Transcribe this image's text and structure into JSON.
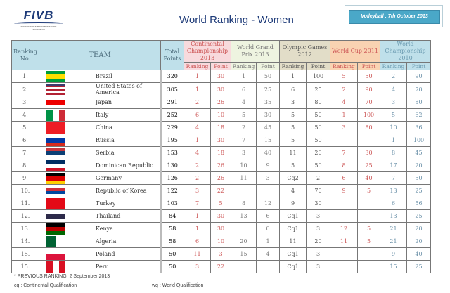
{
  "logo": {
    "name": "FIVB",
    "subtitle": "FEDERATION INTERNATIONALE DE VOLLEYBALL"
  },
  "title": "World Ranking - Women",
  "date_label": "Volleyball : 7th October 2013",
  "headers": {
    "rank": "Ranking No.",
    "team": "TEAM",
    "total": "Total Points",
    "cc": "Continental Championship 2013",
    "gp": "World Grand Prix 2013",
    "og": "Olympic Games 2012",
    "wc": "World Cup 2011",
    "wch": "World Championship 2010",
    "sub_rank": "Ranking",
    "sub_point": "Point"
  },
  "rows": [
    {
      "no": "1.",
      "team": "Brazil",
      "total": "320",
      "v": [
        "1",
        "30",
        "1",
        "50",
        "1",
        "100",
        "5",
        "50",
        "2",
        "90"
      ],
      "flag": {
        "dir": "h",
        "colors": [
          "#009c3b",
          "#ffdf00",
          "#009c3b"
        ]
      }
    },
    {
      "no": "2.",
      "team": "United States of America",
      "total": "305",
      "v": [
        "1",
        "30",
        "6",
        "25",
        "6",
        "25",
        "2",
        "90",
        "4",
        "70"
      ],
      "flag": {
        "dir": "h",
        "colors": [
          "#3c3b6e",
          "#b22234",
          "#fff",
          "#b22234",
          "#fff",
          "#b22234"
        ]
      }
    },
    {
      "no": "3.",
      "team": "Japan",
      "total": "291",
      "v": [
        "2",
        "26",
        "4",
        "35",
        "3",
        "80",
        "4",
        "70",
        "3",
        "80"
      ],
      "flag": {
        "dir": "h",
        "colors": [
          "#fff",
          "#e00",
          "#fff"
        ]
      }
    },
    {
      "no": "4.",
      "team": "Italy",
      "total": "252",
      "v": [
        "6",
        "10",
        "5",
        "30",
        "5",
        "50",
        "1",
        "100",
        "5",
        "62"
      ],
      "flag": {
        "dir": "v",
        "colors": [
          "#009246",
          "#fff",
          "#ce2b37"
        ]
      }
    },
    {
      "no": "5.",
      "team": "China",
      "total": "229",
      "v": [
        "4",
        "18",
        "2",
        "45",
        "5",
        "50",
        "3",
        "80",
        "10",
        "36"
      ],
      "flag": {
        "dir": "h",
        "colors": [
          "#ee1c25"
        ]
      }
    },
    {
      "no": "6.",
      "team": "Russia",
      "total": "195",
      "v": [
        "1",
        "30",
        "7",
        "15",
        "5",
        "50",
        "",
        "",
        "1",
        "100"
      ],
      "flag": {
        "dir": "h",
        "colors": [
          "#fff",
          "#0039a6",
          "#d52b1e"
        ]
      }
    },
    {
      "no": "7.",
      "team": "Serbia",
      "total": "153",
      "v": [
        "4",
        "18",
        "3",
        "40",
        "11",
        "20",
        "7",
        "30",
        "8",
        "45"
      ],
      "flag": {
        "dir": "h",
        "colors": [
          "#c6363c",
          "#0c4076",
          "#fff"
        ]
      }
    },
    {
      "no": "8.",
      "team": "Dominican Republic",
      "total": "130",
      "v": [
        "2",
        "26",
        "10",
        "9",
        "5",
        "50",
        "8",
        "25",
        "17",
        "20"
      ],
      "flag": {
        "dir": "h",
        "colors": [
          "#002d62",
          "#fff",
          "#ce1126"
        ]
      }
    },
    {
      "no": "9.",
      "team": "Germany",
      "total": "126",
      "v": [
        "2",
        "26",
        "11",
        "3",
        "Cq2",
        "2",
        "6",
        "40",
        "7",
        "50"
      ],
      "flag": {
        "dir": "h",
        "colors": [
          "#000",
          "#dd0000",
          "#ffce00"
        ]
      }
    },
    {
      "no": "10.",
      "team": "Republic of Korea",
      "total": "122",
      "v": [
        "3",
        "22",
        "",
        "",
        "4",
        "70",
        "9",
        "5",
        "13",
        "25"
      ],
      "flag": {
        "dir": "h",
        "colors": [
          "#fff",
          "#cd2e3a",
          "#0047a0",
          "#fff"
        ]
      }
    },
    {
      "no": "11.",
      "team": "Turkey",
      "total": "103",
      "v": [
        "7",
        "5",
        "8",
        "12",
        "9",
        "30",
        "",
        "",
        "6",
        "56"
      ],
      "flag": {
        "dir": "h",
        "colors": [
          "#e30a17"
        ]
      }
    },
    {
      "no": "12.",
      "team": "Thailand",
      "total": "84",
      "v": [
        "1",
        "30",
        "13",
        "6",
        "Cq1",
        "3",
        "",
        "",
        "13",
        "25"
      ],
      "flag": {
        "dir": "h",
        "colors": [
          "#fff",
          "#2d2a4a",
          "#fff"
        ]
      }
    },
    {
      "no": "13.",
      "team": "Kenya",
      "total": "58",
      "v": [
        "1",
        "30",
        "",
        "0",
        "Cq1",
        "3",
        "12",
        "5",
        "21",
        "20"
      ],
      "flag": {
        "dir": "h",
        "colors": [
          "#000",
          "#bb0000",
          "#006600"
        ]
      }
    },
    {
      "no": "14.",
      "team": "Algeria",
      "total": "58",
      "v": [
        "6",
        "10",
        "20",
        "1",
        "11",
        "20",
        "11",
        "5",
        "21",
        "20"
      ],
      "flag": {
        "dir": "v",
        "colors": [
          "#006233",
          "#fff"
        ]
      }
    },
    {
      "no": "15.",
      "team": "Poland",
      "total": "50",
      "v": [
        "11",
        "3",
        "15",
        "4",
        "Cq1",
        "3",
        "",
        "",
        "9",
        "40"
      ],
      "flag": {
        "dir": "h",
        "colors": [
          "#fff",
          "#dc143c"
        ]
      }
    },
    {
      "no": "15.",
      "team": "Peru",
      "total": "50",
      "v": [
        "3",
        "22",
        "",
        "",
        "Cq1",
        "3",
        "",
        "",
        "15",
        "25"
      ],
      "flag": {
        "dir": "v",
        "colors": [
          "#d91023",
          "#fff",
          "#d91023"
        ]
      }
    }
  ],
  "footer": {
    "previous": "* PREVIOUS RANKING: 2 September 2013",
    "cq": "cq : Continental Qualification",
    "wq": "wq : World Qualification"
  }
}
